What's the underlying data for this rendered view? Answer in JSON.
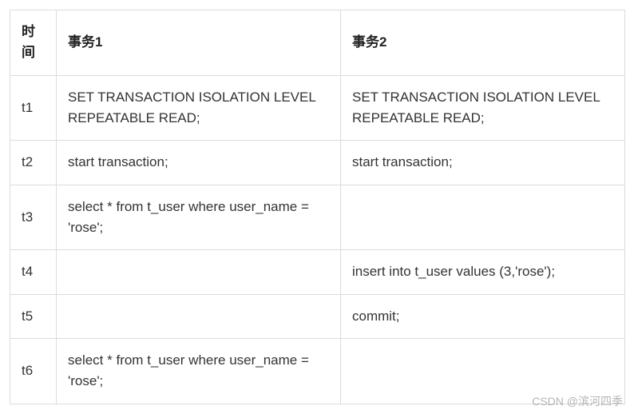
{
  "table": {
    "headers": {
      "time": "时间",
      "tx1": "事务1",
      "tx2": "事务2"
    },
    "rows": [
      {
        "time": "t1",
        "tx1": "SET TRANSACTION ISOLATION LEVEL REPEATABLE READ;",
        "tx2": "SET TRANSACTION ISOLATION LEVEL REPEATABLE READ;"
      },
      {
        "time": "t2",
        "tx1": "start transaction;",
        "tx2": "start transaction;"
      },
      {
        "time": "t3",
        "tx1": "select * from t_user where user_name = 'rose';",
        "tx2": ""
      },
      {
        "time": "t4",
        "tx1": "",
        "tx2": "insert into t_user values (3,'rose');"
      },
      {
        "time": "t5",
        "tx1": "",
        "tx2": "commit;"
      },
      {
        "time": "t6",
        "tx1": "select * from t_user where user_name = 'rose';",
        "tx2": ""
      }
    ]
  },
  "watermark": "CSDN @滨河四季"
}
